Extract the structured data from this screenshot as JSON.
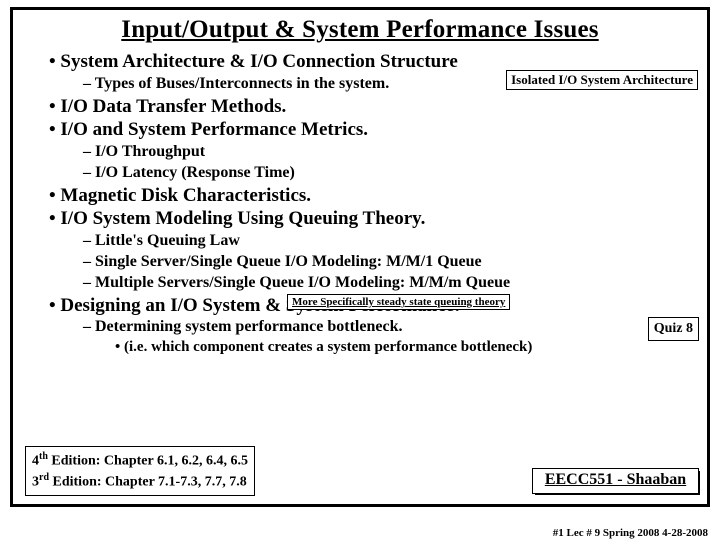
{
  "title": "Input/Output & System Performance Issues",
  "bullets": {
    "sysArch": "System Architecture & I/O Connection Structure",
    "busTypes": "Types of Buses/Interconnects in the system.",
    "ioData": "I/O Data Transfer Methods.",
    "ioPerf": "I/O  and System Performance Metrics.",
    "throughput": "I/O Throughput",
    "latency": "I/O Latency (Response Time)",
    "disk": "Magnetic Disk Characteristics.",
    "queuing": "I/O System Modeling Using Queuing Theory.",
    "little": "Little's Queuing Law",
    "mm1": "Single Server/Single Queue I/O Modeling: M/M/1 Queue",
    "mmm": "Multiple Servers/Single Queue I/O Modeling: M/M/m Queue",
    "design": "Designing an I/O System & System Performance:",
    "bottleneck": "Determining system performance bottleneck.",
    "bottleneckNote": "(i.e. which component creates a system performance bottleneck)"
  },
  "boxes": {
    "iso": "Isolated I/O System Architecture",
    "queuingNote": "More Specifically steady state queuing theory",
    "quiz": "Quiz 8",
    "ed4a": "4",
    "ed4b": " Edition: Chapter  6.1, 6.2, 6.4, 6.5",
    "ed3a": "3",
    "ed3b": " Edition: Chapter  7.1-7.3,  7.7, 7.8",
    "sup": "th",
    "sup2": "rd",
    "course": "EECC551 - Shaaban"
  },
  "footer": "#1    Lec # 9   Spring 2008  4-28-2008"
}
